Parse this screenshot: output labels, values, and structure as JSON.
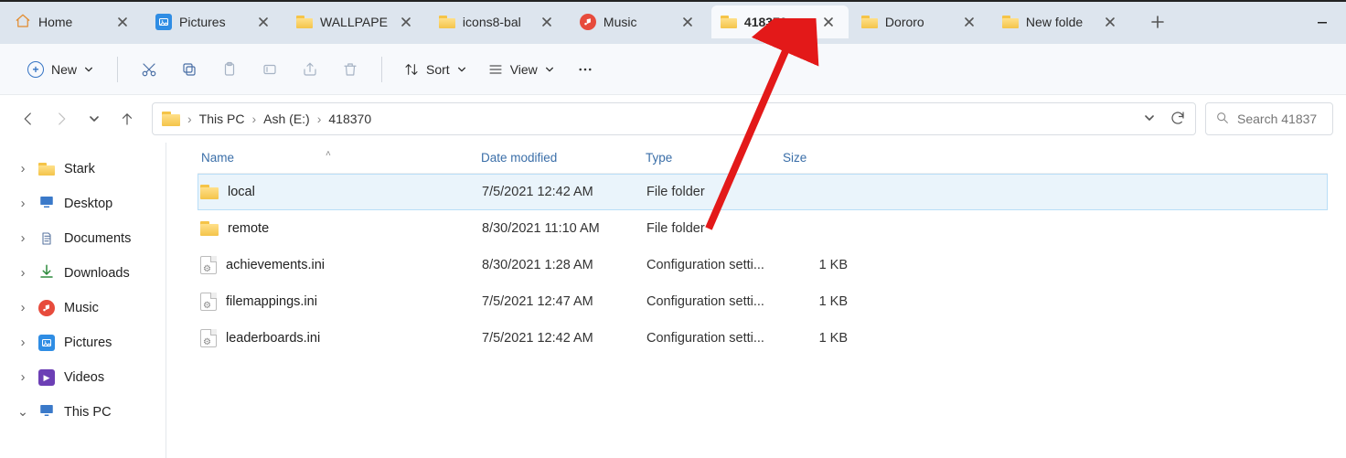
{
  "window": {
    "tabs": [
      {
        "label": "Home",
        "icon": "home-icon"
      },
      {
        "label": "Pictures",
        "icon": "pictures-app-icon"
      },
      {
        "label": "WALLPAPE",
        "icon": "folder-icon"
      },
      {
        "label": "icons8-bal",
        "icon": "folder-icon"
      },
      {
        "label": "Music",
        "icon": "music-app-icon"
      },
      {
        "label": "418370",
        "icon": "folder-icon",
        "active": true
      },
      {
        "label": "Dororo",
        "icon": "folder-icon"
      },
      {
        "label": "New folde",
        "icon": "folder-icon"
      }
    ]
  },
  "toolbar": {
    "new_label": "New",
    "sort_label": "Sort",
    "view_label": "View"
  },
  "address": {
    "crumbs": [
      "This PC",
      "Ash (E:)",
      "418370"
    ]
  },
  "search": {
    "placeholder": "Search 41837"
  },
  "sidebar": {
    "items": [
      {
        "label": "Stark",
        "icon": "folder-icon",
        "caret": ">"
      },
      {
        "label": "Desktop",
        "icon": "desktop-icon",
        "caret": ">"
      },
      {
        "label": "Documents",
        "icon": "document-icon",
        "caret": ">"
      },
      {
        "label": "Downloads",
        "icon": "download-icon",
        "caret": ">"
      },
      {
        "label": "Music",
        "icon": "music-app-icon",
        "caret": ">"
      },
      {
        "label": "Pictures",
        "icon": "pictures-app-icon",
        "caret": ">"
      },
      {
        "label": "Videos",
        "icon": "videos-app-icon",
        "caret": ">"
      },
      {
        "label": "This PC",
        "icon": "thispc-icon",
        "caret": "v"
      }
    ]
  },
  "columns": {
    "name": "Name",
    "date": "Date modified",
    "type": "Type",
    "size": "Size"
  },
  "files": [
    {
      "name": "local",
      "date": "7/5/2021 12:42 AM",
      "type": "File folder",
      "size": "",
      "icon": "folder",
      "selected": true
    },
    {
      "name": "remote",
      "date": "8/30/2021 11:10 AM",
      "type": "File folder",
      "size": "",
      "icon": "folder"
    },
    {
      "name": "achievements.ini",
      "date": "8/30/2021 1:28 AM",
      "type": "Configuration setti...",
      "size": "1 KB",
      "icon": "ini"
    },
    {
      "name": "filemappings.ini",
      "date": "7/5/2021 12:47 AM",
      "type": "Configuration setti...",
      "size": "1 KB",
      "icon": "ini"
    },
    {
      "name": "leaderboards.ini",
      "date": "7/5/2021 12:42 AM",
      "type": "Configuration setti...",
      "size": "1 KB",
      "icon": "ini"
    }
  ]
}
